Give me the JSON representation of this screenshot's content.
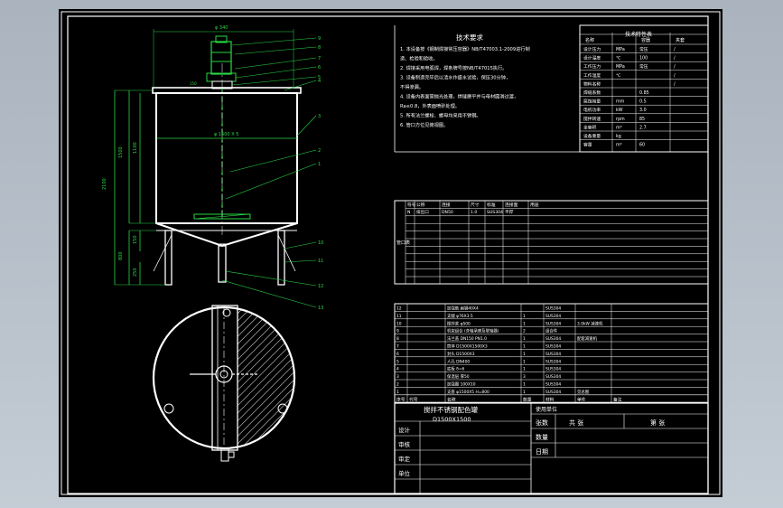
{
  "tech": {
    "title": "技术要求",
    "lines": [
      "1. 本设备按《钢制焊接常压容器》NB/T47003.1-2009进行制",
      "造、检验和验收。",
      "2. 焊接采用电弧焊，焊条牌号按NB/T47015执行。",
      "3. 设备制造完毕后以清水作盛水试验，保压30分钟，",
      "不得渗漏。",
      "4. 设备内表面需抛光处理，焊缝磨平并与母材圆滑过渡，",
      "Ra≤0.8，外表面喷砂处理。",
      "5. 所有法兰螺栓、螺母均采用不锈钢。",
      "6. 管口方位见俯视图。"
    ]
  },
  "spec": {
    "title": "技术特性表",
    "headers": [
      "名称",
      "",
      "容器",
      "夹套"
    ],
    "rows": [
      [
        "设计压力",
        "MPa",
        "常压",
        "/"
      ],
      [
        "设计温度",
        "℃",
        "100",
        "/"
      ],
      [
        "工作压力",
        "MPa",
        "常压",
        "/"
      ],
      [
        "工作温度",
        "℃",
        "",
        "/"
      ],
      [
        "物料名称",
        "",
        "",
        "/"
      ],
      [
        "焊缝系数",
        "",
        "0.85",
        ""
      ],
      [
        "腐蚀裕量",
        "mm",
        "0.5",
        ""
      ],
      [
        "电机功率",
        "kW",
        "3.0",
        ""
      ],
      [
        "搅拌转速",
        "rpm",
        "85",
        ""
      ],
      [
        "全容积",
        "m³",
        "2.7",
        ""
      ],
      [
        "设备重量",
        "kg",
        "",
        ""
      ],
      [
        "容量",
        "m³",
        "60",
        ""
      ]
    ]
  },
  "nozzle": {
    "side_label": "管口表",
    "headers": [
      "符号",
      "公称",
      "连接",
      "尺寸",
      "标准",
      "连接面",
      "用途"
    ],
    "first_row": [
      "N",
      "排出口",
      "DN50",
      "1.0",
      "SUS304",
      "平焊",
      ""
    ]
  },
  "parts": {
    "rows": [
      [
        "12",
        "",
        "加强筋 扁钢40X4",
        "",
        "SUS304",
        ""
      ],
      [
        "11",
        "",
        "支腿 φ76X3.5",
        "1",
        "SUS304",
        ""
      ],
      [
        "10",
        "",
        "搅拌桨 φ500",
        "1",
        "SUS304",
        "3.0kW 减速机"
      ],
      [
        "9",
        "",
        "机架组合 (含轴承座及联轴器)",
        "2",
        "组合件",
        ""
      ],
      [
        "8",
        "",
        "法兰盖 DN150 PN1.0",
        "1",
        "SUS304",
        "配套减速机"
      ],
      [
        "7",
        "",
        "筒体 D1500X1500X3",
        "1",
        "SUS304",
        ""
      ],
      [
        "6",
        "",
        "封头 D1500X3",
        "1",
        "SUS304",
        ""
      ],
      [
        "5",
        "",
        "人孔 DN400",
        "1",
        "SUS304",
        ""
      ],
      [
        "4",
        "",
        "底板 δ=6",
        "1",
        "SUS304",
        ""
      ],
      [
        "3",
        "",
        "保温层 厚50",
        "3",
        "SUS304",
        ""
      ],
      [
        "2",
        "",
        "加强圈 100X10",
        "1",
        "SUS304",
        ""
      ],
      [
        "1",
        "",
        "支座 φ1500X5 H=800",
        "1",
        "SUS304",
        "见总图"
      ]
    ],
    "headers": [
      "序号",
      "代号",
      "名称",
      "数量",
      "材料",
      "单件",
      "备注"
    ]
  },
  "title_block": {
    "name": "搅拌不锈钢配色罐",
    "size": "D1500X1500",
    "unit_label": "使用单位",
    "sheet_a": "张数",
    "sheet_total": "共 张",
    "sheet_no": "第 张",
    "qty": "数量",
    "scale": "比例",
    "date": "日期",
    "roles": [
      "设计",
      "审核",
      "审定",
      "单位"
    ]
  },
  "drawing": {
    "top_dim": "φ 340",
    "shell_dim": "φ 1500 X 5",
    "dim_total": "2100",
    "dim_tank": "1500",
    "dim_cone": "1100",
    "dim_leg": "800",
    "dim_small1": "150",
    "dim_small2": "250",
    "dim_h": "150",
    "callouts": [
      "9",
      "8",
      "7",
      "6",
      "5",
      "4",
      "3",
      "2",
      "1",
      "10",
      "11",
      "12",
      "13"
    ]
  }
}
